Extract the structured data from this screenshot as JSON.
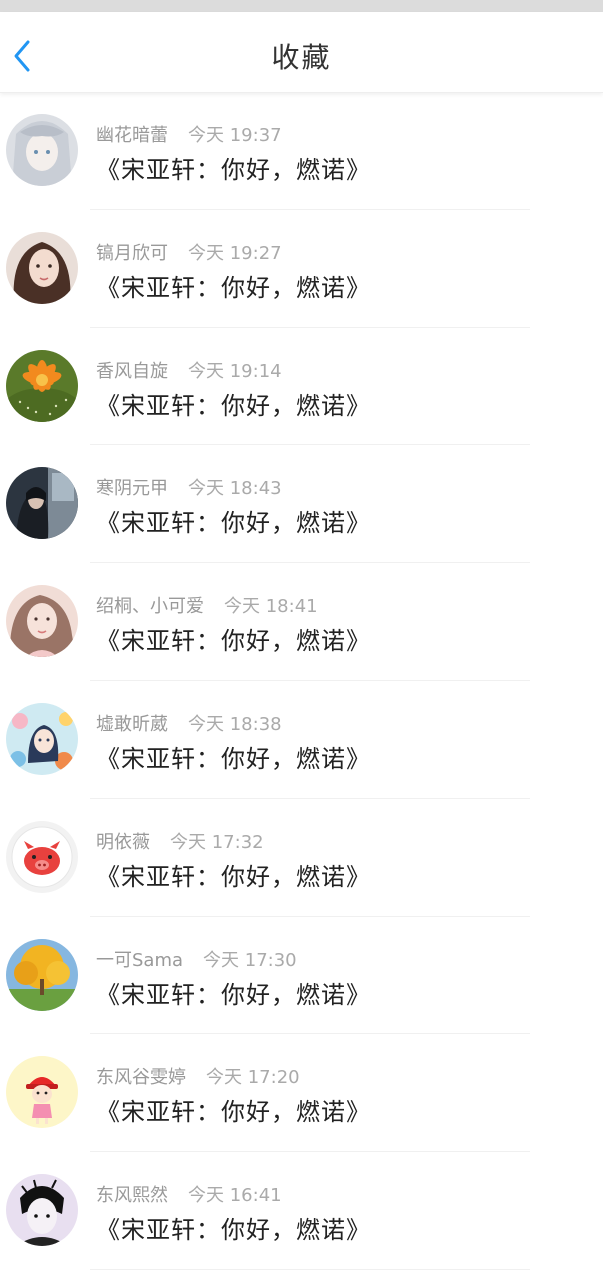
{
  "header": {
    "title": "收藏",
    "back_icon": "chevron-left-icon",
    "accent_color": "#2196F3"
  },
  "items": [
    {
      "name": "幽花暗蕾",
      "time": "今天 19:37",
      "message": "《宋亚轩：你好，燃诺》",
      "avatar": "avatar-silver-hair-girl"
    },
    {
      "name": "镐月欣可",
      "time": "今天 19:27",
      "message": "《宋亚轩：你好，燃诺》",
      "avatar": "avatar-girl-portrait"
    },
    {
      "name": "香风自旋",
      "time": "今天 19:14",
      "message": "《宋亚轩：你好，燃诺》",
      "avatar": "avatar-orange-flower"
    },
    {
      "name": "寒阴元甲",
      "time": "今天 18:43",
      "message": "《宋亚轩：你好，燃诺》",
      "avatar": "avatar-girl-dark"
    },
    {
      "name": "绍桐、小可爱",
      "time": "今天 18:41",
      "message": "《宋亚轩：你好，燃诺》",
      "avatar": "avatar-girl-pink"
    },
    {
      "name": "墟敢昕葳",
      "time": "今天 18:38",
      "message": "《宋亚轩：你好，燃诺》",
      "avatar": "avatar-anime"
    },
    {
      "name": "明依薇",
      "time": "今天 17:32",
      "message": "《宋亚轩：你好，燃诺》",
      "avatar": "avatar-pig-cartoon"
    },
    {
      "name": "一可Sama",
      "time": "今天 17:30",
      "message": "《宋亚轩：你好，燃诺》",
      "avatar": "avatar-autumn-tree"
    },
    {
      "name": "东风谷雯婷",
      "time": "今天 17:20",
      "message": "《宋亚轩：你好，燃诺》",
      "avatar": "avatar-cartoon-girl-red-hat"
    },
    {
      "name": "东风熙然",
      "time": "今天 16:41",
      "message": "《宋亚轩：你好，燃诺》",
      "avatar": "avatar-sketch-man"
    }
  ]
}
